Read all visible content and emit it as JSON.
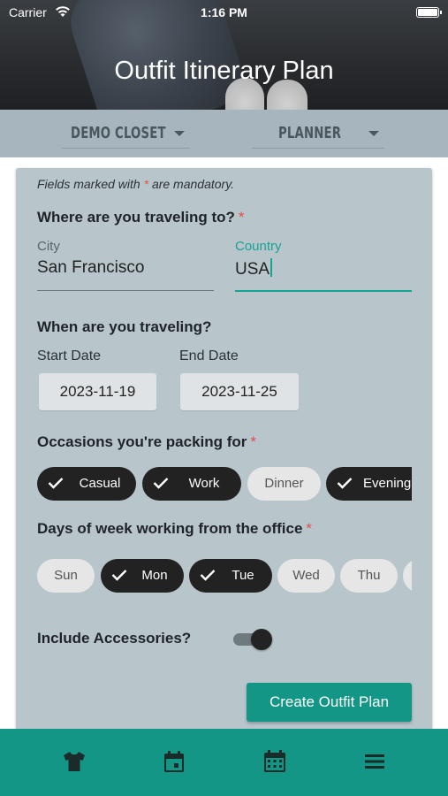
{
  "status_bar": {
    "carrier": "Carrier",
    "time": "1:16 PM"
  },
  "header": {
    "title": "Outfit Itinerary Plan"
  },
  "dropdowns": [
    {
      "label": "DEMO CLOSET"
    },
    {
      "label": "PLANNER"
    }
  ],
  "form": {
    "mandatory_note": "Fields marked with",
    "mandatory_star": "*",
    "mandatory_suffix": "are mandatory.",
    "destination": {
      "heading": "Where are you traveling to?",
      "city_label": "City",
      "city_value": "San Francisco",
      "country_label": "Country",
      "country_value": "USA"
    },
    "dates": {
      "heading": "When are you traveling?",
      "start_label": "Start Date",
      "start_value": "2023-11-19",
      "end_label": "End Date",
      "end_value": "2023-11-25"
    },
    "occasions": {
      "heading": "Occasions you're packing for",
      "chips": [
        {
          "label": "Casual",
          "selected": true
        },
        {
          "label": "Work",
          "selected": true
        },
        {
          "label": "Dinner",
          "selected": false
        },
        {
          "label": "Evening",
          "selected": true
        }
      ]
    },
    "office_days": {
      "heading": "Days of week working from the office",
      "chips": [
        {
          "label": "Sun",
          "selected": false
        },
        {
          "label": "Mon",
          "selected": true
        },
        {
          "label": "Tue",
          "selected": true
        },
        {
          "label": "Wed",
          "selected": false
        },
        {
          "label": "Thu",
          "selected": false
        }
      ]
    },
    "accessories": {
      "label": "Include Accessories?",
      "enabled": true
    },
    "submit_label": "Create Outfit Plan"
  },
  "tab_bar": {
    "tabs": [
      {
        "icon": "tshirt-icon"
      },
      {
        "icon": "calendar-icon"
      },
      {
        "icon": "calendar-grid-icon"
      },
      {
        "icon": "menu-icon"
      }
    ]
  },
  "colors": {
    "accent": "#139685",
    "required": "#e84b4b",
    "card": "#b8c6cc",
    "selected_chip": "#222222"
  }
}
